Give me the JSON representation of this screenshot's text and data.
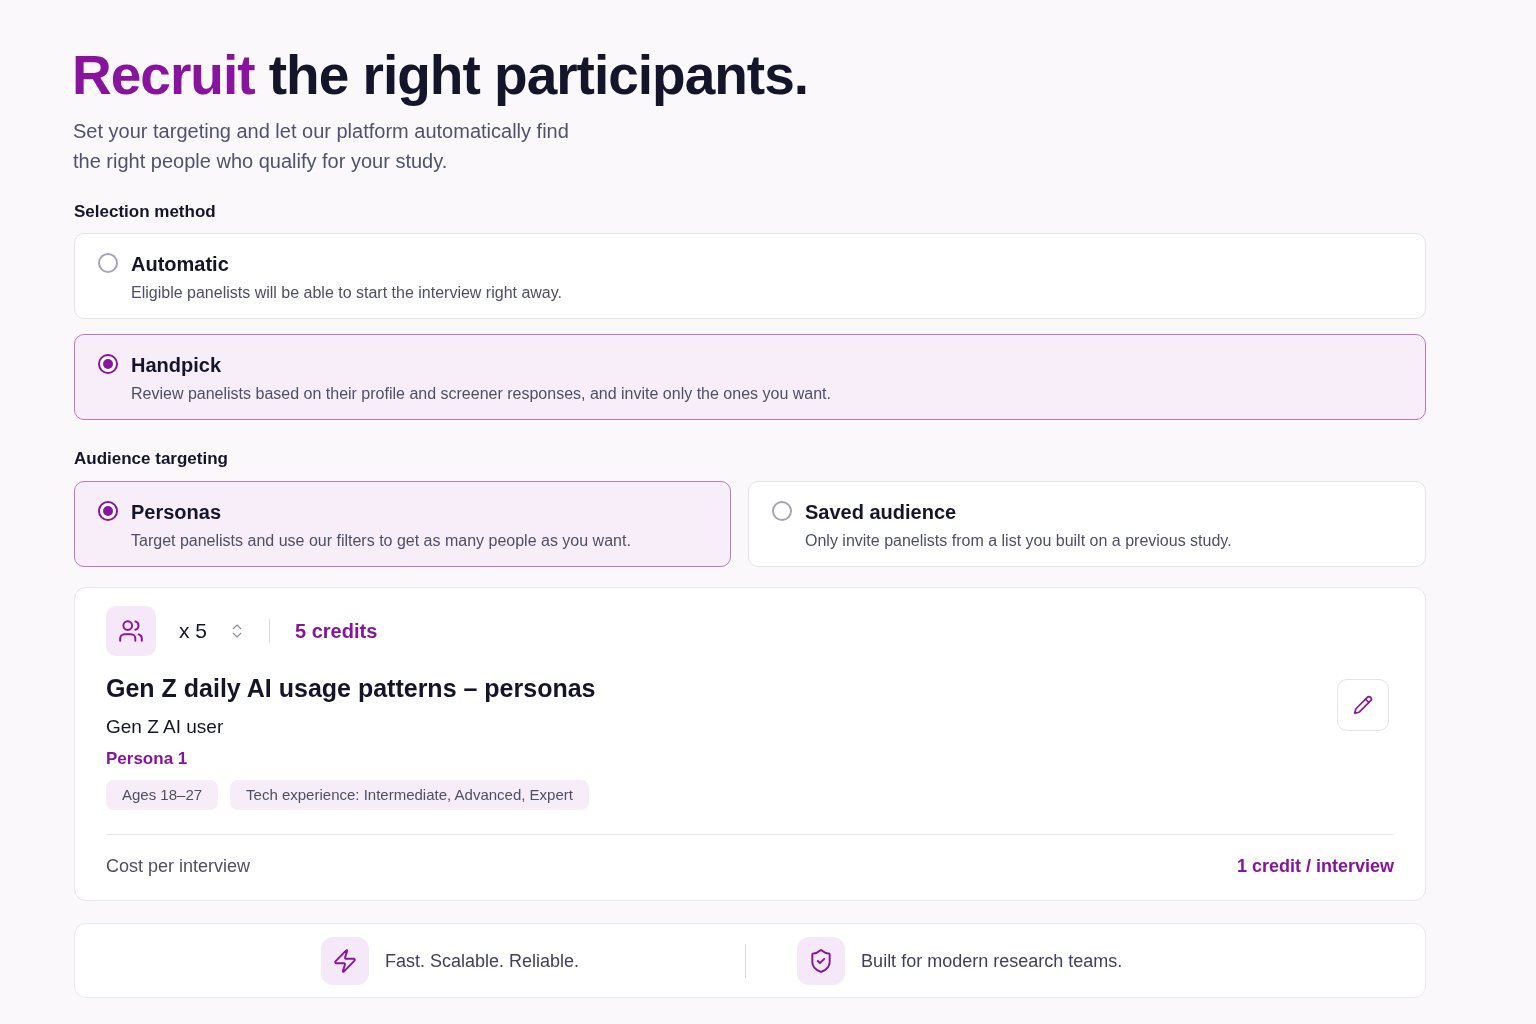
{
  "heading": {
    "highlight": "Recruit",
    "text": "the right participants."
  },
  "subtitle": "Set your targeting and let our platform automatically find the right people who qualify for your study.",
  "selection_method": {
    "label": "Selection method",
    "options": [
      {
        "title": "Automatic",
        "description": "Eligible panelists will be able to start the interview right away.",
        "selected": false
      },
      {
        "title": "Handpick",
        "description": "Review panelists based on their profile and screener responses, and invite only the ones you want.",
        "selected": true
      }
    ]
  },
  "audience_targeting": {
    "label": "Audience targeting",
    "options": [
      {
        "title": "Personas",
        "description": "Target panelists and use our filters to get as many people as you want.",
        "selected": true
      },
      {
        "title": "Saved audience",
        "description": "Only invite panelists from a list you built on a previous study.",
        "selected": false
      }
    ]
  },
  "persona_card": {
    "count": "x 5",
    "credits": "5 credits",
    "title": "Gen Z daily AI usage patterns – personas",
    "persona_name": "Gen Z AI user",
    "persona_label": "Persona 1",
    "tags": [
      "Ages 18–27",
      "Tech experience: Intermediate, Advanced, Expert"
    ],
    "cost_label": "Cost per interview",
    "cost_value": "1 credit / interview"
  },
  "footer": {
    "items": [
      {
        "text": "Fast. Scalable. Reliable."
      },
      {
        "text": "Built for modern research teams."
      }
    ]
  }
}
